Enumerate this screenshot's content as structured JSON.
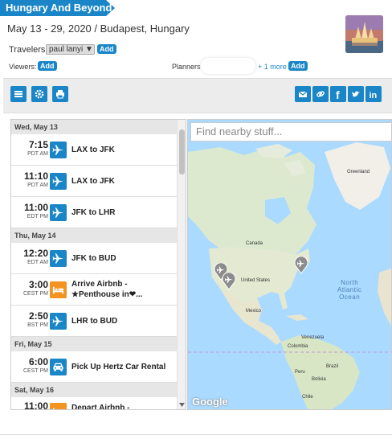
{
  "trip": {
    "title": "Hungary And Beyond",
    "dates_location": "May 13 - 29, 2020 / Budapest, Hungary",
    "travelers_label": "Travelers:",
    "traveler_selected": "paul lanyi",
    "add_label": "Add",
    "viewers_label": "Viewers:",
    "planners_label": "Planners",
    "more_planners": "+ 1 more"
  },
  "colors": {
    "accent": "#1a86c8",
    "lodging": "#f39422"
  },
  "toolbar": {
    "left_icons": [
      "menu-icon",
      "gear-icon",
      "print-icon"
    ],
    "right_icons": [
      "email-icon",
      "link-icon",
      "facebook-icon",
      "twitter-icon",
      "linkedin-icon"
    ]
  },
  "itinerary": {
    "days": [
      {
        "label": "Wed, May 13",
        "items": [
          {
            "time": "7:15",
            "tz": "PDT AM",
            "type": "flight",
            "desc": "LAX to JFK"
          },
          {
            "time": "11:10",
            "tz": "PDT AM",
            "type": "flight",
            "desc": "LAX to JFK"
          },
          {
            "time": "11:00",
            "tz": "EDT PM",
            "type": "flight",
            "desc": "JFK to LHR"
          }
        ]
      },
      {
        "label": "Thu, May 14",
        "items": [
          {
            "time": "12:20",
            "tz": "EDT AM",
            "type": "flight",
            "desc": "JFK to BUD"
          },
          {
            "time": "3:00",
            "tz": "CEST PM",
            "type": "lodging",
            "desc": "Arrive Airbnb -",
            "desc2": "★Penthouse in❤..."
          },
          {
            "time": "2:50",
            "tz": "BST PM",
            "type": "flight",
            "desc": "LHR to BUD"
          }
        ]
      },
      {
        "label": "Fri, May 15",
        "items": [
          {
            "time": "6:00",
            "tz": "CEST PM",
            "type": "car",
            "desc": "Pick Up Hertz Car Rental"
          }
        ]
      },
      {
        "label": "Sat, May 16",
        "items": [
          {
            "time": "11:00",
            "tz": "",
            "type": "lodging",
            "desc": "Depart Airbnb -"
          }
        ]
      }
    ]
  },
  "map": {
    "search_placeholder": "Find nearby stuff...",
    "labels": [
      "Greenland",
      "Canada",
      "United States",
      "Mexico",
      "Venezuela",
      "Colombia",
      "Peru",
      "Brazil",
      "Bolivia",
      "Chile"
    ],
    "ocean": "North Atlantic Ocean",
    "ocean_lines": [
      "North",
      "Atlantic",
      "Ocean"
    ],
    "attribution": "Google"
  }
}
